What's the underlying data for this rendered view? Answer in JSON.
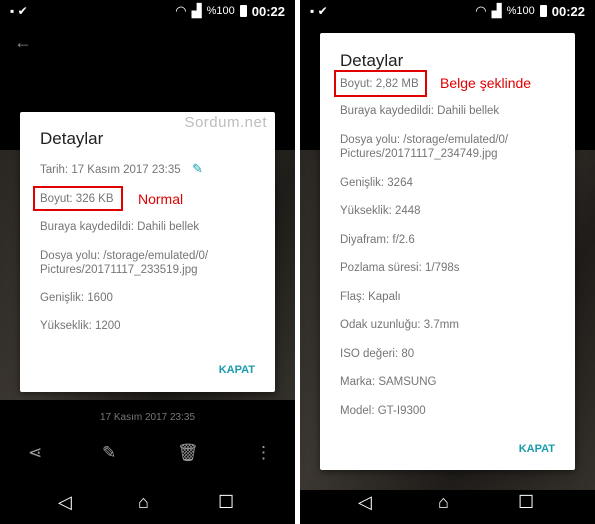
{
  "status": {
    "time": "00:22",
    "battery": "%100"
  },
  "left": {
    "dialog_title": "Detaylar",
    "rows": [
      "Tarih: 17 Kasım 2017 23:35",
      "Boyut: 326 KB",
      "Buraya kaydedildi: Dahili bellek",
      "Dosya yolu: /storage/emulated/0/",
      "Pictures/20171117_233519.jpg",
      "Genişlik: 1600",
      "Yükseklik: 1200"
    ],
    "close_label": "KAPAT",
    "annotation": "Normal",
    "watermark": "Sordum.net",
    "photo_date": "17 Kasım 2017 23:35"
  },
  "right": {
    "dialog_title": "Detaylar",
    "rows": [
      "Boyut: 2,82 MB",
      "Buraya kaydedildi: Dahili bellek",
      "Dosya yolu: /storage/emulated/0/",
      "Pictures/20171117_234749.jpg",
      "Genişlik: 3264",
      "Yükseklik: 2448",
      "Diyafram: f/2.6",
      "Pozlama süresi: 1/798s",
      "Flaş: Kapalı",
      "Odak uzunluğu: 3.7mm",
      "ISO değeri: 80",
      "Marka: SAMSUNG",
      "Model: GT-I9300"
    ],
    "close_label": "KAPAT",
    "annotation": "Belge şeklinde"
  },
  "colors": {
    "accent": "#1a9cae",
    "highlight": "#e00000"
  }
}
